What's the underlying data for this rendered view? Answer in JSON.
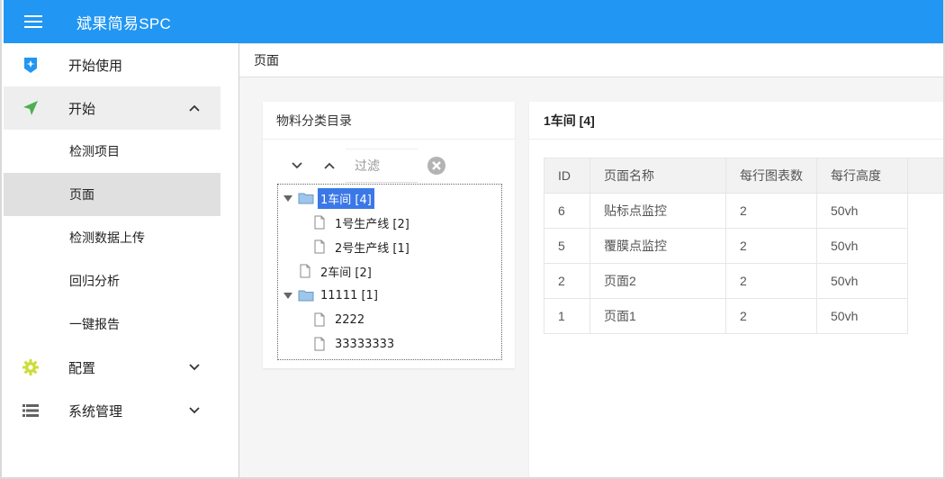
{
  "header": {
    "title": "斌果简易SPC",
    "menu_icon": "hamburger-icon",
    "color": "#2196f3"
  },
  "sidebar": {
    "items": [
      {
        "label": "开始使用",
        "icon": "sparkle-badge-icon",
        "icon_color": "#2196f3"
      },
      {
        "label": "开始",
        "icon": "send-arrow-icon",
        "icon_color": "#4caf50",
        "expanded": true,
        "children": [
          {
            "label": "检测项目"
          },
          {
            "label": "页面",
            "active": true
          },
          {
            "label": "检测数据上传"
          },
          {
            "label": "回归分析"
          },
          {
            "label": "一键报告"
          }
        ]
      },
      {
        "label": "配置",
        "icon": "gear-icon",
        "icon_color": "#cddc39"
      },
      {
        "label": "系统管理",
        "icon": "list-icon",
        "icon_color": "#616161"
      }
    ]
  },
  "breadcrumb": {
    "label": "页面"
  },
  "tree_panel": {
    "title": "物料分类目录",
    "filter_placeholder": "过滤",
    "nodes": [
      {
        "label": "1车间 [4]",
        "type": "folder",
        "selected": true
      },
      {
        "label": "1号生产线 [2]",
        "type": "file"
      },
      {
        "label": "2号生产线 [1]",
        "type": "file"
      },
      {
        "label": "2车间 [2]",
        "type": "file"
      },
      {
        "label": "11111 [1]",
        "type": "folder"
      },
      {
        "label": "2222",
        "type": "file"
      },
      {
        "label": "33333333",
        "type": "file"
      }
    ]
  },
  "pages_panel": {
    "title": "1车间 [4]",
    "columns": [
      "ID",
      "页面名称",
      "每行图表数",
      "每行高度"
    ],
    "rows": [
      [
        "6",
        "贴标点监控",
        "2",
        "50vh"
      ],
      [
        "5",
        "覆膜点监控",
        "2",
        "50vh"
      ],
      [
        "2",
        "页面2",
        "2",
        "50vh"
      ],
      [
        "1",
        "页面1",
        "2",
        "50vh"
      ]
    ]
  }
}
